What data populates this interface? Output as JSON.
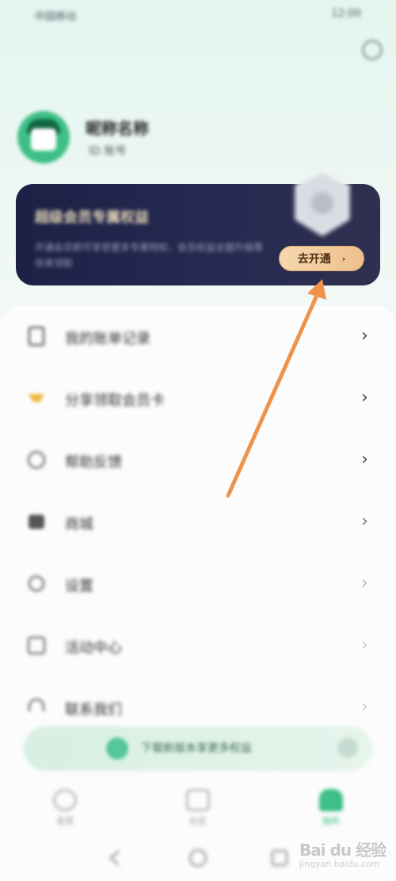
{
  "statusbar": {
    "left": "中国移动",
    "right": "12:00"
  },
  "profile": {
    "username": "昵称名称",
    "subtitle": "ID 账号"
  },
  "vip_card": {
    "title": "超级会员专属权益",
    "description": "开通会员即可享受更多专属特权，会员权益全面升级等你来领取",
    "button_label": "去开通",
    "button_chevron": "›"
  },
  "menu": {
    "items": [
      {
        "label": "我的账单记录",
        "icon": "receipt-icon",
        "arrow": "›"
      },
      {
        "label": "分享领取会员卡",
        "icon": "gift-icon",
        "arrow": "›"
      },
      {
        "label": "帮助反馈",
        "icon": "help-icon",
        "arrow": "›"
      },
      {
        "label": "商城",
        "icon": "store-icon",
        "arrow": "›"
      },
      {
        "label": "设置",
        "icon": "settings-icon",
        "arrow": "›"
      },
      {
        "label": "活动中心",
        "icon": "event-icon",
        "arrow": "›"
      },
      {
        "label": "联系我们",
        "icon": "headset-icon",
        "arrow": "›"
      }
    ]
  },
  "banner": {
    "text": "下载新版本享更多权益"
  },
  "tabs": [
    {
      "label": "发现",
      "icon": "discover-icon"
    },
    {
      "label": "社区",
      "icon": "community-icon"
    },
    {
      "label": "我的",
      "icon": "profile-icon",
      "active": true
    }
  ],
  "watermark": {
    "brand": "Bai du 经验",
    "url": "jingyan.baidu.com"
  },
  "colors": {
    "accent": "#3dbf86",
    "card_dark": "#1c2146",
    "button_gold": "#f0c995",
    "annotation_arrow": "#f0934a"
  }
}
